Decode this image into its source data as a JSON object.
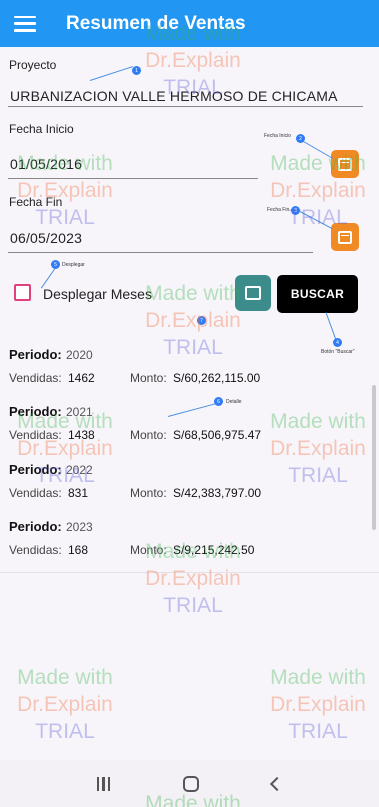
{
  "app": {
    "title": "Resumen de Ventas"
  },
  "form": {
    "proyecto_label": "Proyecto",
    "proyecto_value": "URBANIZACION VALLE HERMOSO DE CHICAMA",
    "fecha_inicio_label": "Fecha Inicio",
    "fecha_inicio_value": "01/05/2016",
    "fecha_fin_label": "Fecha Fin",
    "fecha_fin_value": "06/05/2023",
    "desplegar_label": "Desplegar Meses",
    "buscar_label": "BUSCAR"
  },
  "periods": [
    {
      "label": "Periodo:",
      "year": "2020",
      "sold_label": "Vendidas:",
      "sold": "1462",
      "amount_label": "Monto:",
      "amount": "S/60,262,115.00"
    },
    {
      "label": "Periodo:",
      "year": "2021",
      "sold_label": "Vendidas:",
      "sold": "1438",
      "amount_label": "Monto:",
      "amount": "S/68,506,975.47"
    },
    {
      "label": "Periodo:",
      "year": "2022",
      "sold_label": "Vendidas:",
      "sold": "831",
      "amount_label": "Monto:",
      "amount": "S/42,383,797.00"
    },
    {
      "label": "Periodo:",
      "year": "2023",
      "sold_label": "Vendidas:",
      "sold": "168",
      "amount_label": "Monto:",
      "amount": "S/9,215,242.50"
    }
  ],
  "callouts": {
    "c1": "1",
    "c1_text": "",
    "c2": "2",
    "c2_text": "Fecha Inicio",
    "c3": "3",
    "c3_text": "Fecha Fin",
    "c4": "4",
    "c4_text": "Botón \"Buscar\"",
    "c5": "5",
    "c5_text": "Desplegar",
    "c6": "6",
    "c6_text": "Detalle",
    "c7": "7"
  },
  "watermark": {
    "line1": "Made with",
    "line2": "Dr.Explain",
    "line3": "TRIAL"
  },
  "colors": {
    "appbar": "#2196f3",
    "date_button": "#f08a24",
    "search_button": "#000000",
    "checkbox_border": "#e0407b"
  },
  "icons": {
    "menu": "hamburger-menu-icon",
    "calendar": "calendar-icon",
    "grid": "grid-icon",
    "nav_recent": "recent-apps-icon",
    "nav_home": "home-icon",
    "nav_back": "back-icon"
  }
}
